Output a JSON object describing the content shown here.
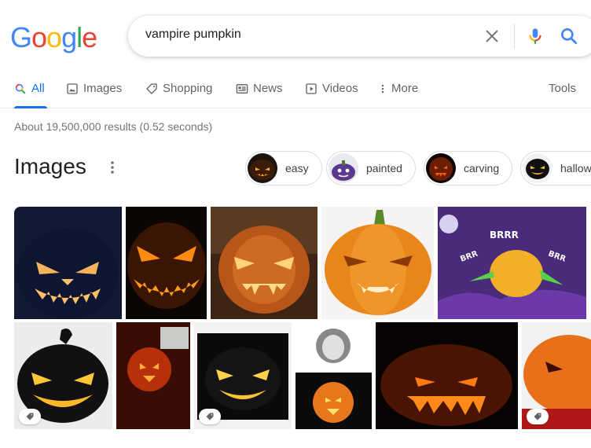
{
  "logo": {
    "letters": [
      "G",
      "o",
      "o",
      "g",
      "l",
      "e"
    ],
    "colors": [
      "#4285F4",
      "#EA4335",
      "#FBBC05",
      "#4285F4",
      "#34A853",
      "#EA4335"
    ]
  },
  "search": {
    "query": "vampire pumpkin",
    "clear_icon": "close-icon",
    "mic_icon": "mic-icon",
    "search_icon": "search-icon"
  },
  "tabs": [
    {
      "label": "All",
      "icon": "search-icon",
      "active": true
    },
    {
      "label": "Images",
      "icon": "image-icon"
    },
    {
      "label": "Shopping",
      "icon": "tag-icon"
    },
    {
      "label": "News",
      "icon": "news-icon"
    },
    {
      "label": "Videos",
      "icon": "play-icon"
    },
    {
      "label": "More",
      "icon": "more-vert-icon"
    }
  ],
  "tools_label": "Tools",
  "stats": "About 19,500,000 results (0.52 seconds)",
  "images_section": {
    "heading": "Images",
    "chips": [
      {
        "label": "easy"
      },
      {
        "label": "painted"
      },
      {
        "label": "carving"
      },
      {
        "label": "hallow"
      }
    ]
  },
  "colors": {
    "accent": "#1a73e8",
    "text_secondary": "#70757a",
    "tab_text": "#5f6368"
  }
}
